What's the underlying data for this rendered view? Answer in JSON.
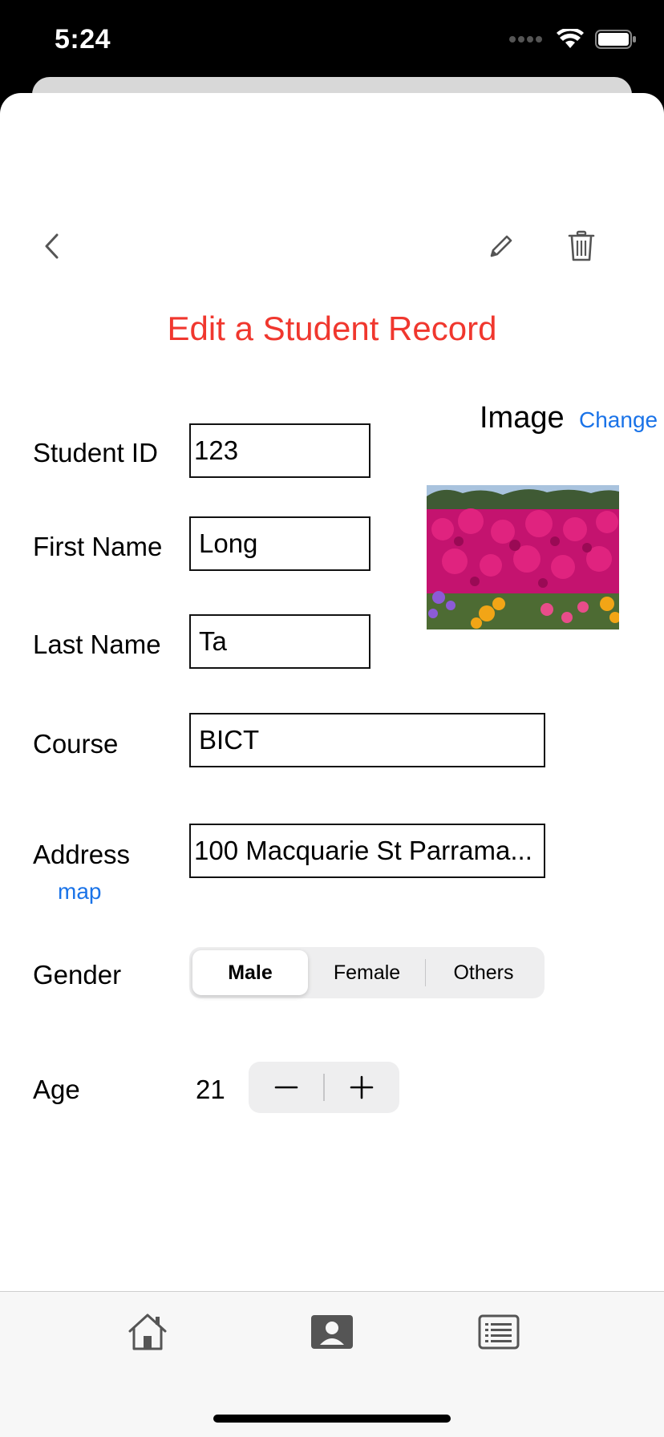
{
  "status": {
    "time": "5:24"
  },
  "nav": {
    "back_icon": "chevron-left-icon",
    "edit_icon": "pencil-icon",
    "delete_icon": "trash-icon"
  },
  "page": {
    "title": "Edit a Student Record"
  },
  "image_section": {
    "label": "Image",
    "change_label": "Change",
    "photo": "pink-flowers-photo"
  },
  "form": {
    "student_id": {
      "label": "Student ID",
      "value": "123"
    },
    "first_name": {
      "label": "First Name",
      "value": "Long"
    },
    "last_name": {
      "label": "Last Name",
      "value": "Ta"
    },
    "course": {
      "label": "Course",
      "value": "BICT"
    },
    "address": {
      "label": "Address",
      "value": "100 Macquarie St Parrama...",
      "map_label": "map"
    },
    "gender": {
      "label": "Gender",
      "options": [
        "Male",
        "Female",
        "Others"
      ],
      "selected": "Male"
    },
    "age": {
      "label": "Age",
      "value": "21"
    }
  },
  "tabs": [
    {
      "icon": "home-icon"
    },
    {
      "icon": "person-card-icon"
    },
    {
      "icon": "list-icon"
    }
  ],
  "colors": {
    "title": "#f0372e",
    "link": "#1a73e8"
  }
}
